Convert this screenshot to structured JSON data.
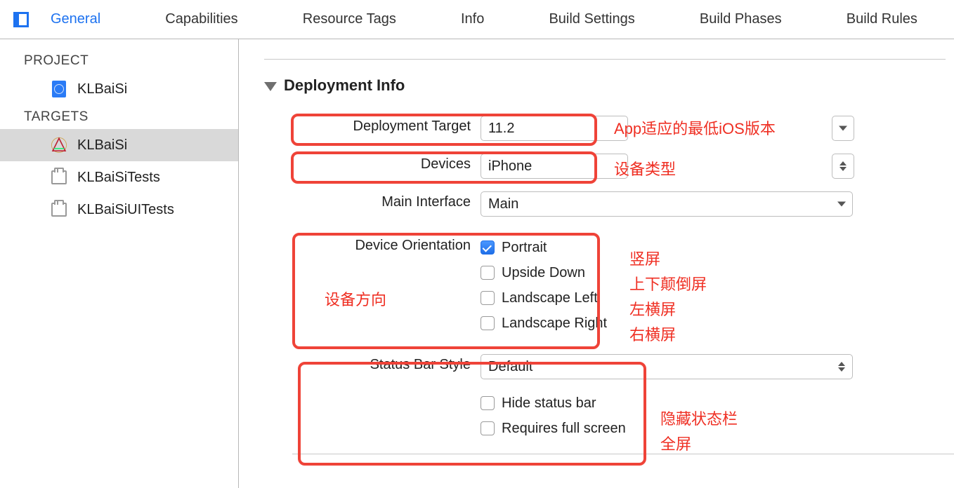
{
  "tabs": {
    "items": [
      "General",
      "Capabilities",
      "Resource Tags",
      "Info",
      "Build Settings",
      "Build Phases",
      "Build Rules"
    ],
    "active_index": 0
  },
  "sidebar": {
    "project_header": "PROJECT",
    "project_name": "KLBaiSi",
    "targets_header": "TARGETS",
    "targets": [
      {
        "label": "KLBaiSi",
        "icon": "app",
        "selected": true
      },
      {
        "label": "KLBaiSiTests",
        "icon": "test",
        "selected": false
      },
      {
        "label": "KLBaiSiUITests",
        "icon": "test",
        "selected": false
      }
    ]
  },
  "section": {
    "title": "Deployment Info"
  },
  "form": {
    "deployment_target": {
      "label": "Deployment Target",
      "value": "11.2"
    },
    "devices": {
      "label": "Devices",
      "value": "iPhone"
    },
    "main_interface": {
      "label": "Main Interface",
      "value": "Main"
    },
    "device_orientation": {
      "label": "Device Orientation",
      "options": [
        {
          "label": "Portrait",
          "checked": true
        },
        {
          "label": "Upside Down",
          "checked": false
        },
        {
          "label": "Landscape Left",
          "checked": false
        },
        {
          "label": "Landscape Right",
          "checked": false
        }
      ]
    },
    "status_bar_style": {
      "label": "Status Bar Style",
      "value": "Default",
      "options": [
        {
          "label": "Hide status bar",
          "checked": false
        },
        {
          "label": "Requires full screen",
          "checked": false
        }
      ]
    }
  },
  "annotations": {
    "deployment_target": "App适应的最低iOS版本",
    "devices": "设备类型",
    "orientation_label": "设备方向",
    "orient": [
      "竖屏",
      "上下颠倒屏",
      "左横屏",
      "右横屏"
    ],
    "status": [
      "隐藏状态栏",
      "全屏"
    ]
  }
}
